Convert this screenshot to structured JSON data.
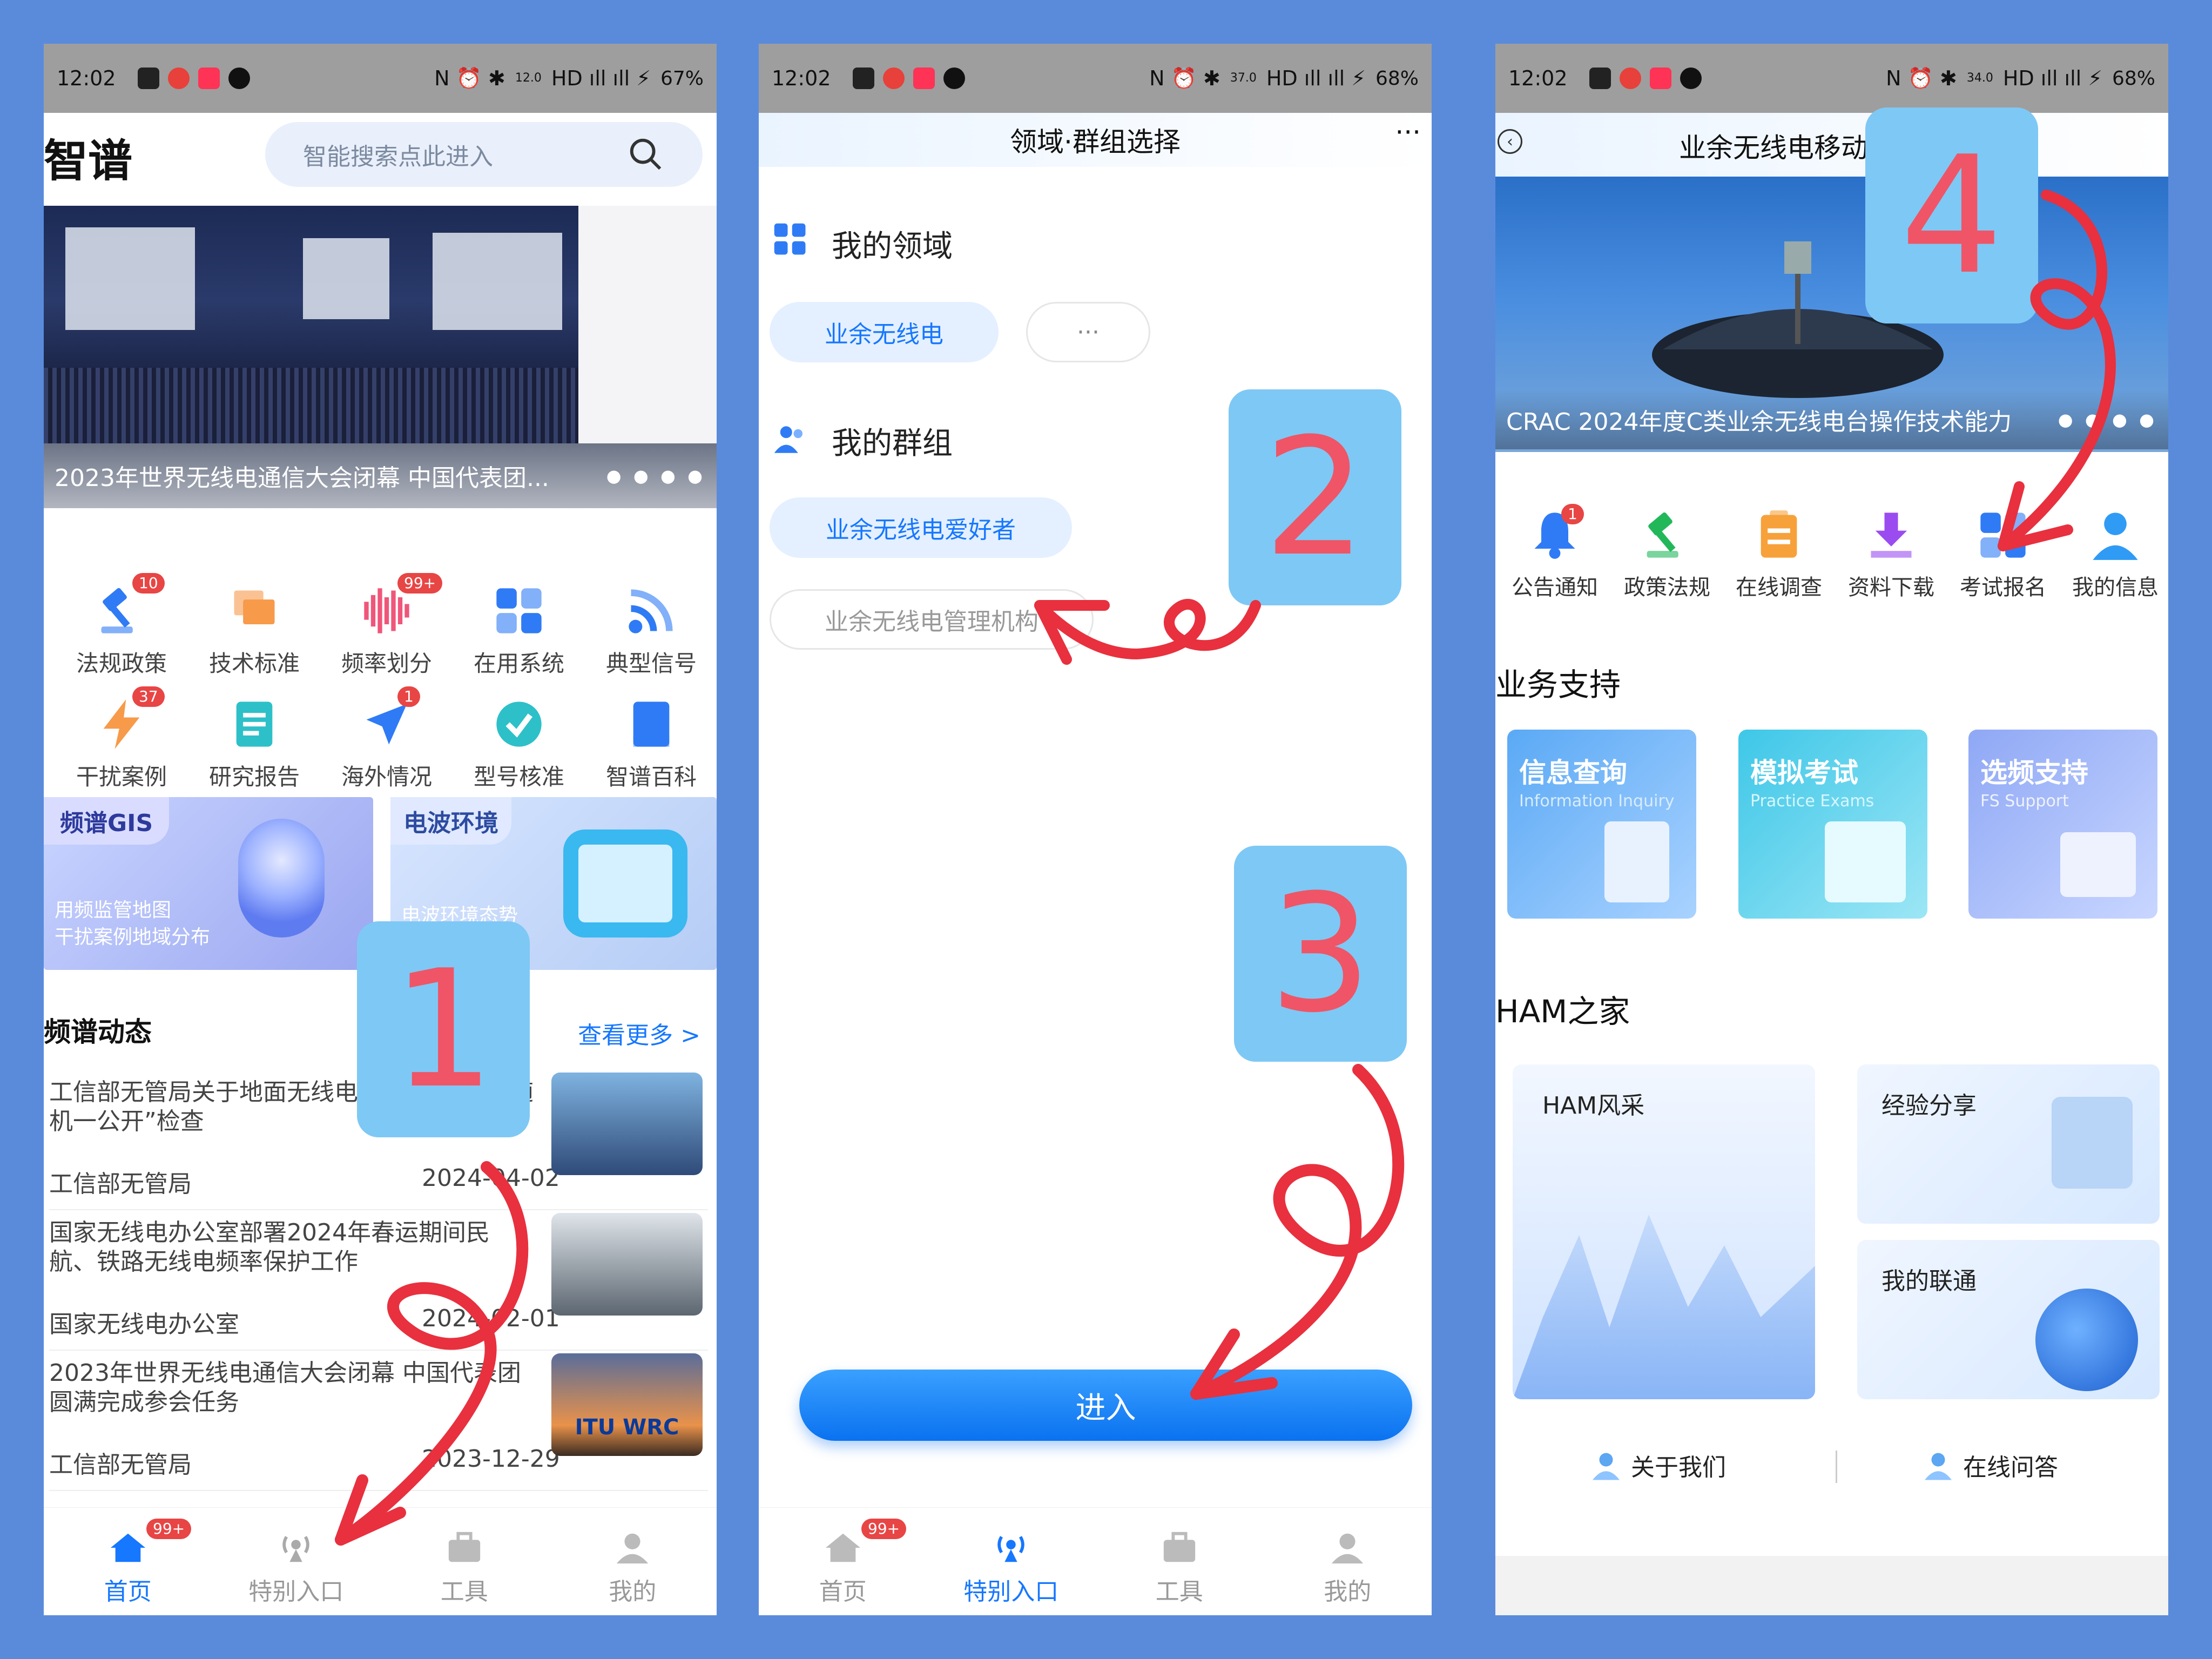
{
  "p1": {
    "status": {
      "time": "12:02",
      "speed": "12.0",
      "battery": "67%"
    },
    "title": "智谱",
    "search_placeholder": "智能搜索点此进入",
    "banner_caption": "2023年世界无线电通信大会闭幕 中国代表团...",
    "grid": [
      {
        "label": "法规政策",
        "badge": "10",
        "icon": "gavel-icon",
        "color": "#2f7bf5"
      },
      {
        "label": "技术标准",
        "badge": "",
        "icon": "flag-icon",
        "color": "#f79a4a"
      },
      {
        "label": "频率划分",
        "badge": "99+",
        "icon": "waveform-icon",
        "color": "#f0567a"
      },
      {
        "label": "在用系统",
        "badge": "",
        "icon": "apps-icon",
        "color": "#2f7bf5"
      },
      {
        "label": "典型信号",
        "badge": "",
        "icon": "rss-icon",
        "color": "#2f7bf5"
      },
      {
        "label": "干扰案例",
        "badge": "37",
        "icon": "lightning-icon",
        "color": "#f79a4a"
      },
      {
        "label": "研究报告",
        "badge": "",
        "icon": "report-icon",
        "color": "#2dc0c8"
      },
      {
        "label": "海外情况",
        "badge": "1",
        "icon": "plane-icon",
        "color": "#2f7bf5"
      },
      {
        "label": "型号核准",
        "badge": "",
        "icon": "check-icon",
        "color": "#2dc0c8"
      },
      {
        "label": "智谱百科",
        "badge": "",
        "icon": "book-icon",
        "color": "#2f7bf5"
      }
    ],
    "gis": {
      "title": "频谱GIS",
      "line1": "用频监管地图",
      "line2": "干扰案例地域分布"
    },
    "env": {
      "title": "电波环境",
      "sub": "电波环境态势"
    },
    "news_title": "频谱动态",
    "more": "查看更多 >",
    "news": [
      {
        "title": "工信部无管局关于地面无线电 2023年度“双随机一公开”检查",
        "source": "工信部无管局",
        "date": "2024-04-02"
      },
      {
        "title": "国家无线电办公室部署2024年春运期间民航、铁路无线电频率保护工作",
        "source": "国家无线电办公室",
        "date": "2024-02-01"
      },
      {
        "title": "2023年世界无线电通信大会闭幕 中国代表团圆满完成参会任务",
        "source": "工信部无管局",
        "date": "2023-12-29",
        "img_text": "ITU WRC"
      }
    ],
    "tabs": [
      {
        "label": "首页",
        "badge": "99+"
      },
      {
        "label": "特别入口",
        "badge": ""
      },
      {
        "label": "工具",
        "badge": ""
      },
      {
        "label": "我的",
        "badge": ""
      }
    ],
    "step": "1"
  },
  "p2": {
    "status": {
      "time": "12:02",
      "speed": "37.0",
      "battery": "68%"
    },
    "header": "领域·群组选择",
    "menu": "···",
    "domain_title": "我的领域",
    "domain_chips": [
      "业余无线电",
      "···"
    ],
    "group_title": "我的群组",
    "group_chips": [
      "业余无线电爱好者",
      "业余无线电管理机构"
    ],
    "enter": "进入",
    "tabs": [
      {
        "label": "首页",
        "badge": "99+"
      },
      {
        "label": "特别入口",
        "badge": ""
      },
      {
        "label": "工具",
        "badge": ""
      },
      {
        "label": "我的",
        "badge": ""
      }
    ],
    "steps": [
      "2",
      "3"
    ]
  },
  "p3": {
    "status": {
      "time": "12:02",
      "speed": "34.0",
      "battery": "68%"
    },
    "header": "业余无线电移动",
    "banner_caption": "CRAC 2024年度C类业余无线电台操作技术能力",
    "menu": [
      {
        "label": "公告通知",
        "badge": "1",
        "icon": "bell-icon",
        "color": "#2f7bf5"
      },
      {
        "label": "政策法规",
        "badge": "",
        "icon": "gavel-icon",
        "color": "#22b85a"
      },
      {
        "label": "在线调查",
        "badge": "",
        "icon": "clipboard-icon",
        "color": "#f7a13a"
      },
      {
        "label": "资料下载",
        "badge": "",
        "icon": "download-icon",
        "color": "#9a4cf0"
      },
      {
        "label": "考试报名",
        "badge": "",
        "icon": "apps-icon",
        "color": "#2f7bf5"
      },
      {
        "label": "我的信息",
        "badge": "",
        "icon": "user-icon",
        "color": "#2f9bf5"
      }
    ],
    "support_title": "业务支持",
    "support": [
      {
        "title": "信息查询",
        "sub": "Information Inquiry"
      },
      {
        "title": "模拟考试",
        "sub": "Practice Exams"
      },
      {
        "title": "选频支持",
        "sub": "FS Support"
      }
    ],
    "ham_title": "HAM之家",
    "ham": [
      "HAM风采",
      "经验分享",
      "我的联通"
    ],
    "footer": [
      "关于我们",
      "在线问答"
    ],
    "step": "4"
  }
}
